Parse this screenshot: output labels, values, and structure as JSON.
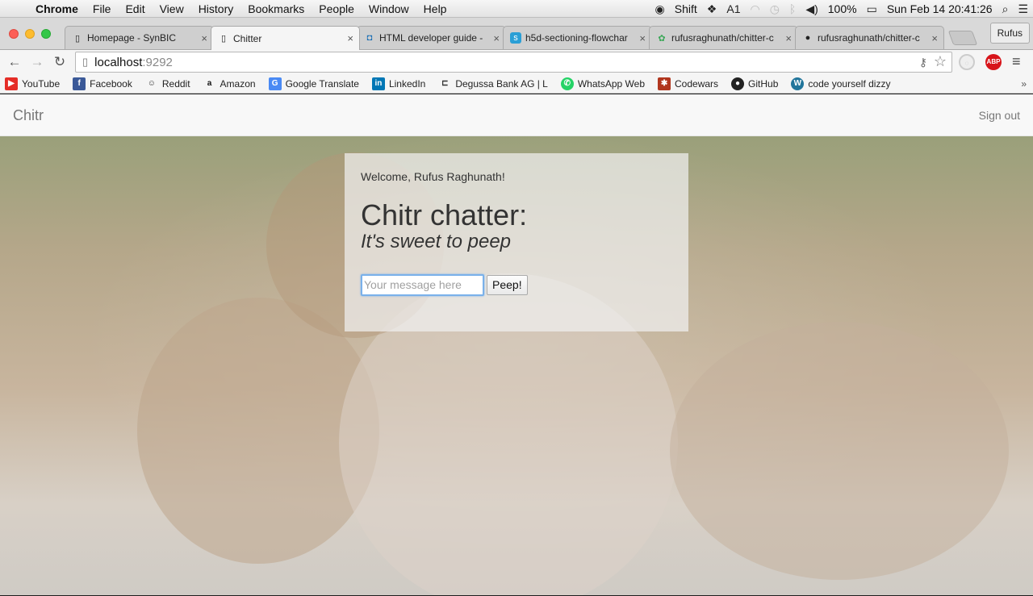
{
  "menubar": {
    "app": "Chrome",
    "items": [
      "File",
      "Edit",
      "View",
      "History",
      "Bookmarks",
      "People",
      "Window",
      "Help"
    ],
    "status": {
      "shift": "Shift",
      "notification_count": "1",
      "battery": "100%",
      "datetime": "Sun Feb 14  20:41:26"
    }
  },
  "browser": {
    "tabs": [
      {
        "title": "Homepage - SynBIC",
        "icon": "page-icon"
      },
      {
        "title": "Chitter",
        "icon": "page-icon",
        "active": true
      },
      {
        "title": "HTML developer guide - ",
        "icon": "guide-icon"
      },
      {
        "title": "h5d-sectioning-flowchar",
        "icon": "s-icon"
      },
      {
        "title": "rufusraghunath/chitter-c",
        "icon": "code-icon"
      },
      {
        "title": "rufusraghunath/chitter-c",
        "icon": "github-icon"
      }
    ],
    "profile": "Rufus",
    "url": {
      "host": "localhost",
      "port": ":9292"
    },
    "bookmarks": [
      {
        "label": "YouTube",
        "icon": "youtube-icon",
        "color": "#e52d27"
      },
      {
        "label": "Facebook",
        "icon": "facebook-icon",
        "color": "#3b5998"
      },
      {
        "label": "Reddit",
        "icon": "reddit-icon",
        "color": "#ffffff"
      },
      {
        "label": "Amazon",
        "icon": "amazon-icon",
        "color": "#ffffff"
      },
      {
        "label": "Google Translate",
        "icon": "translate-icon",
        "color": "#4a8af4"
      },
      {
        "label": "LinkedIn",
        "icon": "linkedin-icon",
        "color": "#0077b5"
      },
      {
        "label": "Degussa Bank AG | L",
        "icon": "degussa-icon",
        "color": "#ffffff"
      },
      {
        "label": "WhatsApp Web",
        "icon": "whatsapp-icon",
        "color": "#25d366"
      },
      {
        "label": "Codewars",
        "icon": "codewars-icon",
        "color": "#b1361e"
      },
      {
        "label": "GitHub",
        "icon": "github-icon",
        "color": "#222222"
      },
      {
        "label": "code yourself dizzy",
        "icon": "wordpress-icon",
        "color": "#21759b"
      }
    ]
  },
  "page": {
    "brand": "Chitr",
    "sign_out": "Sign out",
    "welcome": "Welcome, Rufus Raghunath!",
    "headline": "Chitr chatter:",
    "tagline": "It's sweet to peep",
    "message_placeholder": "Your message here",
    "submit_label": "Peep!"
  }
}
